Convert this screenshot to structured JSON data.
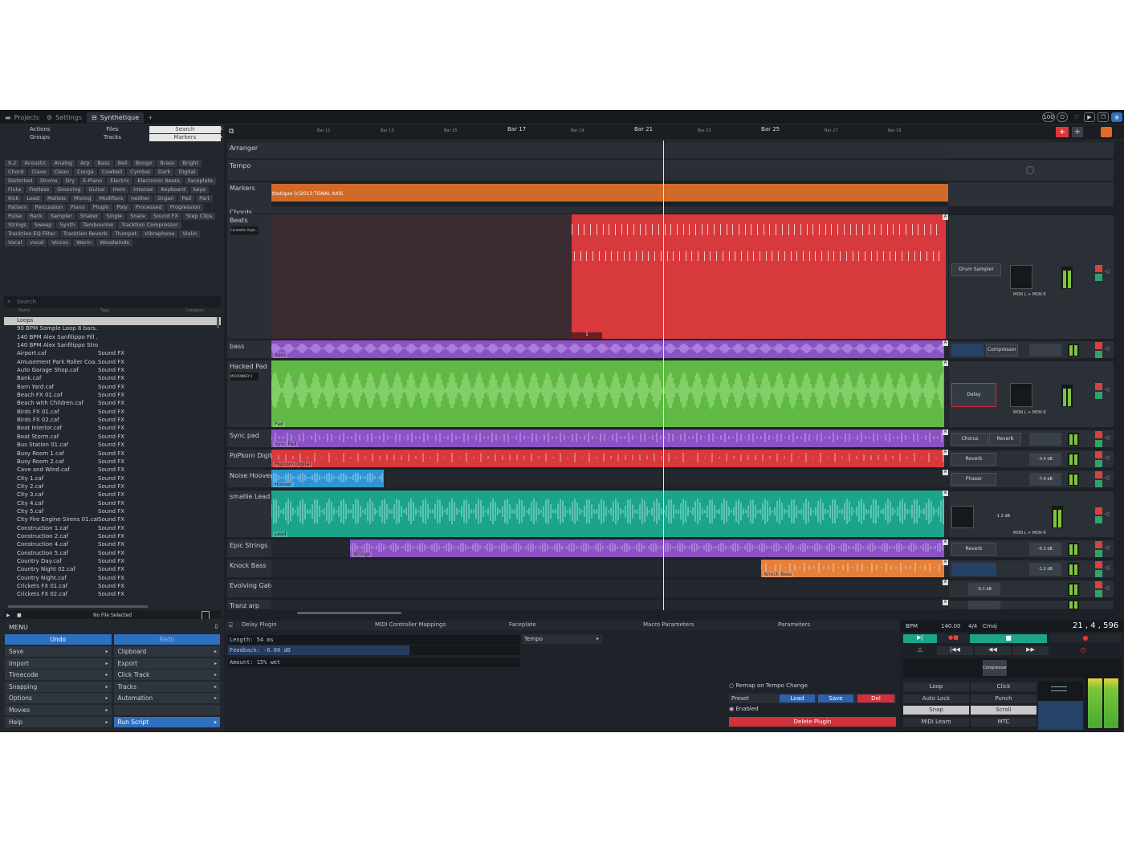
{
  "tabs": {
    "projects": "Projects",
    "settings": "Settings",
    "synthetique": "Synthetique",
    "add": "+"
  },
  "topright": {
    "cpu": "100"
  },
  "browser": {
    "tabs_row1": [
      "Actions",
      "Files",
      "Search"
    ],
    "tabs_row2": [
      "Groups",
      "Tracks",
      "Markers"
    ],
    "tags": [
      "9.2",
      "Acoustic",
      "Analog",
      "Arp",
      "Bass",
      "Bell",
      "Bongo",
      "Brass",
      "Bright",
      "Chord",
      "Clave",
      "Clean",
      "Conga",
      "Cowbell",
      "Cymbal",
      "Dark",
      "Digital",
      "Distorted",
      "Drums",
      "Dry",
      "E-Piano",
      "Electric",
      "Electronic Beats",
      "Faceplate",
      "Flute",
      "Fretless",
      "Grooving",
      "Guitar",
      "Horn",
      "Intense",
      "Keyboard",
      "keys",
      "Kick",
      "Lead",
      "Mallets",
      "Mixing",
      "Modifiers",
      "neither",
      "Organ",
      "Pad",
      "Part",
      "Pattern",
      "Percussion",
      "Piano",
      "Plugin",
      "Poly",
      "Processed",
      "Progression",
      "Pulse",
      "Rack",
      "Sampler",
      "Shaker",
      "Single",
      "Snare",
      "Sound FX",
      "Step Clips",
      "Strings",
      "Sweep",
      "Synth",
      "Tambourine",
      "Tracktion Compressor",
      "Tracktion EQ Filter",
      "Tracktion Reverb",
      "Trumpet",
      "Vibraphone",
      "Violin",
      "Vocal",
      "vocal",
      "Voices",
      "Warm",
      "Woodwinds"
    ],
    "search_placeholder": "Search",
    "columns": [
      "Name",
      "Tags",
      "Category"
    ],
    "folder": "Loops",
    "loops": [
      "90 BPM Sample Loop 8 bars...",
      "140 BPM Alex Sanfilippo Fill ...",
      "140 BPM Alex Sanfilippo Stro..."
    ],
    "files": [
      [
        "Airport.caf",
        "Sound FX"
      ],
      [
        "Amusement Park Roller Coa...",
        "Sound FX"
      ],
      [
        "Auto Garage Shop.caf",
        "Sound FX"
      ],
      [
        "Bank.caf",
        "Sound FX"
      ],
      [
        "Barn Yard.caf",
        "Sound FX"
      ],
      [
        "Beach FX 01.caf",
        "Sound FX"
      ],
      [
        "Beach with Children.caf",
        "Sound FX"
      ],
      [
        "Birds FX 01.caf",
        "Sound FX"
      ],
      [
        "Birds FX 02.caf",
        "Sound FX"
      ],
      [
        "Boat Interior.caf",
        "Sound FX"
      ],
      [
        "Boat Storm.caf",
        "Sound FX"
      ],
      [
        "Bus Station 01.caf",
        "Sound FX"
      ],
      [
        "Busy Room 1.caf",
        "Sound FX"
      ],
      [
        "Busy Room 2.caf",
        "Sound FX"
      ],
      [
        "Cave and Wind.caf",
        "Sound FX"
      ],
      [
        "City 1.caf",
        "Sound FX"
      ],
      [
        "City 2.caf",
        "Sound FX"
      ],
      [
        "City 3.caf",
        "Sound FX"
      ],
      [
        "City 4.caf",
        "Sound FX"
      ],
      [
        "City 5.caf",
        "Sound FX"
      ],
      [
        "City Fire Engine Sirens 01.caf",
        "Sound FX"
      ],
      [
        "Construction 1.caf",
        "Sound FX"
      ],
      [
        "Construction 2.caf",
        "Sound FX"
      ],
      [
        "Construction 4.caf",
        "Sound FX"
      ],
      [
        "Construction 5.caf",
        "Sound FX"
      ],
      [
        "Country Day.caf",
        "Sound FX"
      ],
      [
        "Country Night 02.caf",
        "Sound FX"
      ],
      [
        "Country Night.caf",
        "Sound FX"
      ],
      [
        "Crickets FX 01.caf",
        "Sound FX"
      ],
      [
        "Crickets FX 02.caf",
        "Sound FX"
      ]
    ],
    "no_file": "No File Selected"
  },
  "menu": {
    "title": "MENU",
    "undo": "Undo",
    "redo": "Redo",
    "rows": [
      [
        "Save",
        "Clipboard"
      ],
      [
        "Import",
        "Export"
      ],
      [
        "Timecode",
        "Click Track"
      ],
      [
        "Snapping",
        "Tracks"
      ],
      [
        "Options",
        "Automation"
      ],
      [
        "Movies",
        ""
      ],
      [
        "Help",
        "Run Script"
      ]
    ]
  },
  "ruler": {
    "bars": [
      "Bar 11",
      "Bar 13",
      "Bar 15",
      "Bar 17",
      "Bar 19",
      "Bar 21",
      "Bar 23",
      "Bar 25",
      "Bar 27",
      "Bar 29"
    ]
  },
  "tracks": {
    "arranger": "Arranger",
    "tempo": "Tempo",
    "markers": "Markers",
    "marker_text": "thetique (c)2013 TONAL AXIS",
    "chords": "Chords",
    "beats": "Beats",
    "beats_plugin": "Controller Keyb...",
    "beats_clip_num": "1",
    "bass": "bass",
    "bass_clip": "Bass",
    "hacked_pad": "Hacked Pad",
    "hacked_plugin": "MICRONKEY-1",
    "pad_clip": "Pad",
    "sync_pad": "Sync pad",
    "sync_clip": "Sync Pad",
    "popkorn": "PoPkorn Digital",
    "popkorn_clip": "Popcorn Digital",
    "noise_hoover": "Noise Hoover",
    "hoover_clip": "Hoover",
    "smallie": "smallie Lead",
    "lead_clip": "Lead",
    "epic": "Epic Strings",
    "strings_clip": "Strings",
    "knock": "Knock Bass",
    "knock_clip": "Knock Bass",
    "evolving": "Evolving Gate",
    "tranz": "Tranz arp"
  },
  "rack": {
    "drum": "Drum Sampler",
    "mon": "MON L + MON R",
    "compressor": "Compressor",
    "delay": "Delay",
    "chorus": "Chorus",
    "reverb": "Reverb",
    "phaser": "Phaser",
    "db_sync": "-3.4 dB",
    "db_phaser": "-7.9 dB",
    "db_smallie": "-1.2 dB",
    "db_epic": "-6.3 dB",
    "db_knock": "-1.2 dB",
    "db_evolve": "-6.1 dB"
  },
  "plugin": {
    "tabs": [
      "Delay Plugin",
      "MIDI Controller Mappings",
      "Faceplate",
      "Macro Parameters",
      "Parameters"
    ],
    "length": "Length: 54 ms",
    "feedback": "Feedback: -6.00 dB",
    "amount": "Amount: 15% wet",
    "feedback_fill": 0.62,
    "tempo": "Tempo",
    "remap": "Remap on Tempo Change",
    "preset": "Preset",
    "load": "Load",
    "save": "Save",
    "del": "Del",
    "enabled": "Enabled",
    "delete": "Delete Plugin"
  },
  "transport": {
    "bpm_label": "BPM",
    "bpm": "140.00",
    "sig": "4/4",
    "key": "Cmaj",
    "position": "21 , 4 , 596",
    "compressor": "Compressor",
    "buttons": [
      [
        "Loop",
        "Click"
      ],
      [
        "Auto Lock",
        "Punch"
      ],
      [
        "Snap",
        "Scroll"
      ],
      [
        "MIDI Learn",
        "MTC"
      ]
    ]
  },
  "colors": {
    "beats": "#d8393d",
    "bass": "#8b52c4",
    "pad": "#5fb944",
    "popkorn": "#d8393d",
    "hoover": "#2e95d4",
    "lead": "#1ba48a",
    "strings": "#8b52c4",
    "knock": "#e5803a",
    "marker": "#d06a2a"
  }
}
